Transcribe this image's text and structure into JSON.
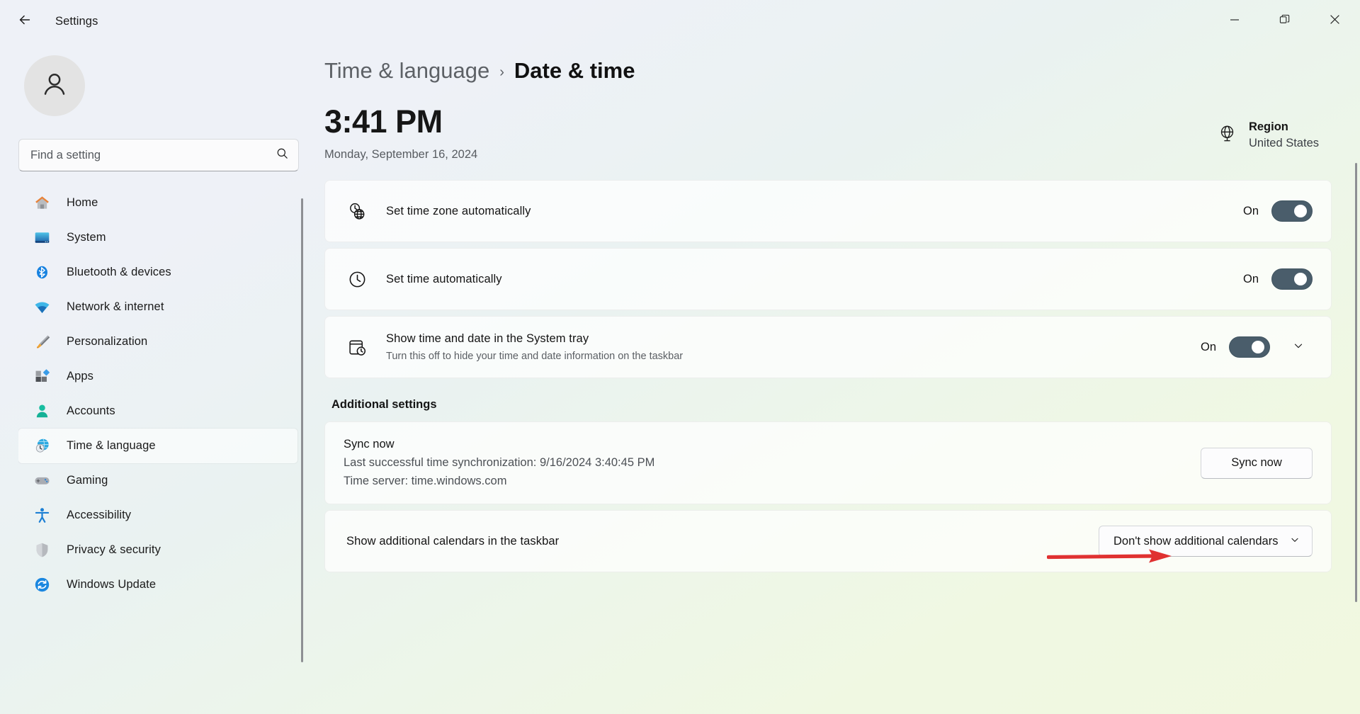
{
  "window": {
    "title": "Settings",
    "back_icon": "arrow-left-icon",
    "controls": {
      "minimize": "minimize-icon",
      "maximize": "restore-icon",
      "close": "close-icon"
    }
  },
  "sidebar": {
    "avatar_icon": "person-avatar-icon",
    "search": {
      "placeholder": "Find a setting",
      "value": "",
      "icon": "search-icon"
    },
    "items": [
      {
        "label": "Home",
        "icon": "home-icon",
        "selected": false
      },
      {
        "label": "System",
        "icon": "system-icon",
        "selected": false
      },
      {
        "label": "Bluetooth & devices",
        "icon": "bluetooth-icon",
        "selected": false
      },
      {
        "label": "Network & internet",
        "icon": "network-icon",
        "selected": false
      },
      {
        "label": "Personalization",
        "icon": "paintbrush-icon",
        "selected": false
      },
      {
        "label": "Apps",
        "icon": "apps-icon",
        "selected": false
      },
      {
        "label": "Accounts",
        "icon": "accounts-icon",
        "selected": false
      },
      {
        "label": "Time & language",
        "icon": "time-language-icon",
        "selected": true
      },
      {
        "label": "Gaming",
        "icon": "gaming-icon",
        "selected": false
      },
      {
        "label": "Accessibility",
        "icon": "accessibility-icon",
        "selected": false
      },
      {
        "label": "Privacy & security",
        "icon": "shield-icon",
        "selected": false
      },
      {
        "label": "Windows Update",
        "icon": "windows-update-icon",
        "selected": false
      }
    ]
  },
  "breadcrumb": {
    "parent": "Time & language",
    "separator": "›",
    "current": "Date & time"
  },
  "clock": {
    "time": "3:41 PM",
    "date": "Monday, September 16, 2024"
  },
  "region": {
    "icon": "globe-icon",
    "title": "Region",
    "value": "United States"
  },
  "settings_cards": [
    {
      "icon": "clock-globe-icon",
      "title": "Set time zone automatically",
      "subtitle": "",
      "toggle_label": "On",
      "toggle_state": "on",
      "has_chevron": false
    },
    {
      "icon": "clock-icon",
      "title": "Set time automatically",
      "subtitle": "",
      "toggle_label": "On",
      "toggle_state": "on",
      "has_chevron": false
    },
    {
      "icon": "system-tray-clock-icon",
      "title": "Show time and date in the System tray",
      "subtitle": "Turn this off to hide your time and date information on the taskbar",
      "toggle_label": "On",
      "toggle_state": "on",
      "has_chevron": true,
      "chevron_icon": "chevron-down-icon"
    }
  ],
  "additional": {
    "heading": "Additional settings",
    "sync": {
      "title": "Sync now",
      "last_sync": "Last successful time synchronization: 9/16/2024 3:40:45 PM",
      "time_server": "Time server: time.windows.com",
      "button_label": "Sync now"
    },
    "calendars": {
      "label": "Show additional calendars in the taskbar",
      "selected_option": "Don't show additional calendars",
      "chevron_icon": "chevron-down-icon"
    }
  },
  "annotation": {
    "type": "arrow",
    "color": "#e03131",
    "points_to": "sync-now-button"
  }
}
